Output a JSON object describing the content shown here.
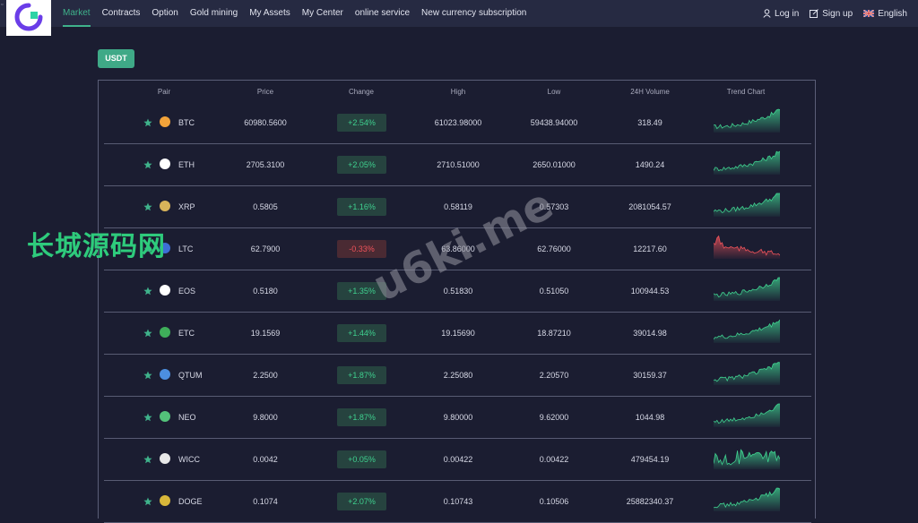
{
  "nav": {
    "links": [
      {
        "label": "Market",
        "active": true
      },
      {
        "label": "Contracts"
      },
      {
        "label": "Option"
      },
      {
        "label": "Gold mining"
      },
      {
        "label": "My Assets"
      },
      {
        "label": "My Center"
      },
      {
        "label": "online service"
      },
      {
        "label": "New currency subscription"
      }
    ],
    "login": "Log in",
    "signup": "Sign up",
    "language": "English"
  },
  "tab": {
    "label": "USDT"
  },
  "table": {
    "headers": [
      "Pair",
      "Price",
      "Change",
      "High",
      "Low",
      "24H Volume",
      "Trend Chart"
    ],
    "rows": [
      {
        "pair": "BTC",
        "price": "60980.5600",
        "change": "+2.54%",
        "high": "61023.98000",
        "low": "59438.94000",
        "volume": "318.49",
        "trend": "up",
        "icon_color": "#f2a33a",
        "icon": "bitcoin-icon"
      },
      {
        "pair": "ETH",
        "price": "2705.3100",
        "change": "+2.05%",
        "high": "2710.51000",
        "low": "2650.01000",
        "volume": "1490.24",
        "trend": "up",
        "icon_color": "#ffffff",
        "icon": "ethereum-icon"
      },
      {
        "pair": "XRP",
        "price": "0.5805",
        "change": "+1.16%",
        "high": "0.58119",
        "low": "0.57303",
        "volume": "2081054.57",
        "trend": "up",
        "icon_color": "#d9b45a",
        "icon": "xrp-icon"
      },
      {
        "pair": "LTC",
        "price": "62.7900",
        "change": "-0.33%",
        "high": "63.86000",
        "low": "62.76000",
        "volume": "12217.60",
        "trend": "down",
        "icon_color": "#3d6fd6",
        "icon": "litecoin-icon"
      },
      {
        "pair": "EOS",
        "price": "0.5180",
        "change": "+1.35%",
        "high": "0.51830",
        "low": "0.51050",
        "volume": "100944.53",
        "trend": "up",
        "icon_color": "#ffffff",
        "icon": "eos-icon"
      },
      {
        "pair": "ETC",
        "price": "19.1569",
        "change": "+1.44%",
        "high": "19.15690",
        "low": "18.87210",
        "volume": "39014.98",
        "trend": "up",
        "icon_color": "#3fae5a",
        "icon": "etc-icon"
      },
      {
        "pair": "QTUM",
        "price": "2.2500",
        "change": "+1.87%",
        "high": "2.25080",
        "low": "2.20570",
        "volume": "30159.37",
        "trend": "up",
        "icon_color": "#4c8fe0",
        "icon": "qtum-icon"
      },
      {
        "pair": "NEO",
        "price": "9.8000",
        "change": "+1.87%",
        "high": "9.80000",
        "low": "9.62000",
        "volume": "1044.98",
        "trend": "up",
        "icon_color": "#53c27a",
        "icon": "neo-icon"
      },
      {
        "pair": "WICC",
        "price": "0.0042",
        "change": "+0.05%",
        "high": "0.00422",
        "low": "0.00422",
        "volume": "479454.19",
        "trend": "flat",
        "icon_color": "#e8e8e8",
        "icon": "wicc-icon"
      },
      {
        "pair": "DOGE",
        "price": "0.1074",
        "change": "+2.07%",
        "high": "0.10743",
        "low": "0.10506",
        "volume": "25882340.37",
        "trend": "up",
        "icon_color": "#d8b73a",
        "icon": "doge-icon"
      }
    ]
  },
  "colors": {
    "accent": "#3fb28b",
    "up": "#3fd18f",
    "down": "#f0535b"
  },
  "watermarks": {
    "cn": "长城源码网",
    "en": "u6ki.me"
  }
}
